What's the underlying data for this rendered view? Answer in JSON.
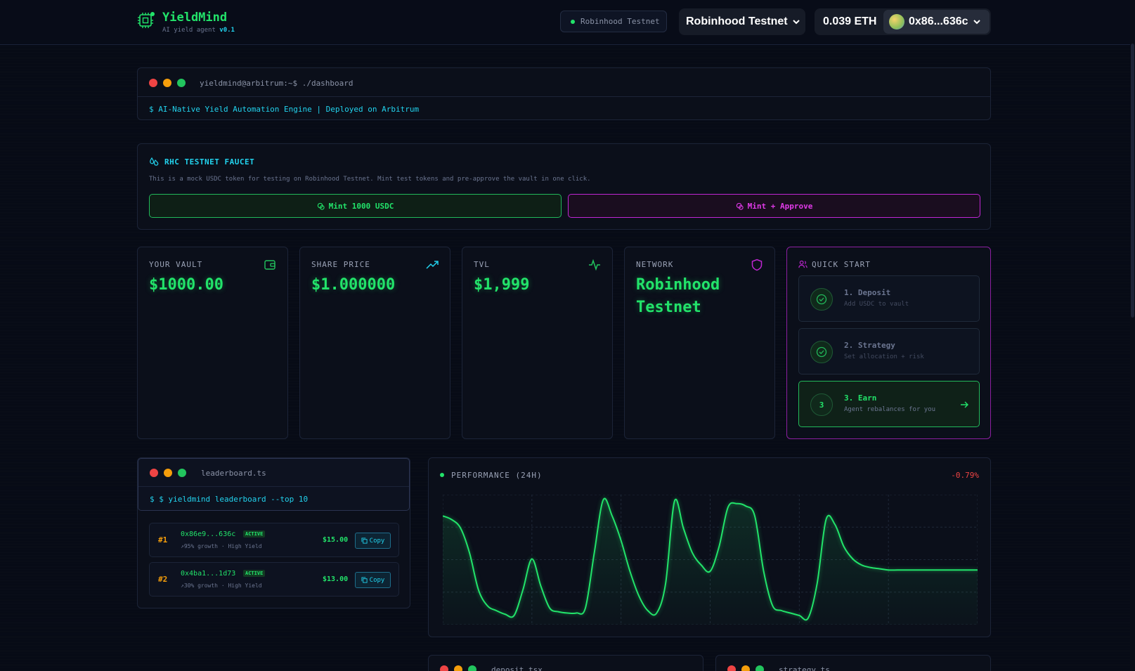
{
  "header": {
    "brand": "YieldMind",
    "tagline": "AI yield agent",
    "version": "v0.1",
    "network_pill": "Robinhood Testnet",
    "network_select": "Robinhood Testnet",
    "balance": "0.039 ETH",
    "account": "0x86...636c"
  },
  "terminal": {
    "title": "yieldmind@arbitrum:~$ ./dashboard",
    "command": "$ AI-Native Yield Automation Engine | Deployed on Arbitrum"
  },
  "faucet": {
    "title": "RHC TESTNET FAUCET",
    "description": "This is a mock USDC token for testing on Robinhood Testnet. Mint test tokens and pre-approve the vault in one click.",
    "mint_label": "Mint 1000 USDC",
    "approve_label": "Mint + Approve"
  },
  "stats": [
    {
      "label": "YOUR VAULT",
      "value": "$1000.00",
      "icon": "wallet-icon"
    },
    {
      "label": "SHARE PRICE",
      "value": "$1.000000",
      "icon": "trending-up-icon"
    },
    {
      "label": "TVL",
      "value": "$1,999",
      "icon": "activity-icon"
    },
    {
      "label": "NETWORK",
      "value": "Robinhood Testnet",
      "icon": "shield-icon"
    }
  ],
  "quickstart": {
    "title": "QUICK START",
    "steps": [
      {
        "title": "1. Deposit",
        "sub": "Add USDC to vault"
      },
      {
        "title": "2. Strategy",
        "sub": "Set allocation + risk"
      },
      {
        "title": "3. Earn",
        "sub": "Agent rebalances for you",
        "num": "3"
      }
    ]
  },
  "leaderboard": {
    "title": "leaderboard.ts",
    "command": "$ $ yieldmind leaderboard --top 10",
    "rows": [
      {
        "rank": "#1",
        "address": "0x86e9...636c",
        "badge": "ACTIVE",
        "growth": "95% growth",
        "tier": "· High Yield",
        "amount": "$15.00",
        "copy": "Copy"
      },
      {
        "rank": "#2",
        "address": "0x4ba1...1d73",
        "badge": "ACTIVE",
        "growth": "30% growth",
        "tier": "· High Yield",
        "amount": "$13.00",
        "copy": "Copy"
      }
    ]
  },
  "performance": {
    "title": "PERFORMANCE (24H)",
    "change": "-0.79%"
  },
  "bottom": {
    "left_title": "deposit.tsx",
    "right_title": "strategy.ts"
  },
  "colors": {
    "accent_green": "#22e36a",
    "accent_cyan": "#22d3ee",
    "accent_magenta": "#e03ae8",
    "negative": "#ef4444"
  },
  "chart_data": {
    "type": "line",
    "title": "PERFORMANCE (24H)",
    "x": [
      0,
      1,
      2,
      3,
      4,
      5,
      6,
      7,
      8,
      9,
      10,
      11,
      12,
      13,
      14,
      15,
      16,
      17,
      18,
      19,
      20,
      21,
      22,
      23,
      24,
      25,
      26,
      27,
      28,
      29,
      30,
      31,
      32,
      33,
      34,
      35,
      36,
      37,
      38,
      39,
      40,
      41,
      42,
      43,
      44,
      45,
      46,
      47,
      48,
      49,
      50,
      51,
      52,
      53,
      54,
      55,
      56,
      57,
      58,
      59,
      60
    ],
    "series": [
      {
        "values": [
          0.85,
          0.82,
          0.75,
          0.55,
          0.25,
          0.12,
          0.08,
          0.05,
          0.04,
          0.25,
          0.5,
          0.28,
          0.1,
          0.07,
          0.06,
          0.06,
          0.1,
          0.55,
          0.98,
          0.85,
          0.65,
          0.4,
          0.2,
          0.08,
          0.06,
          0.3,
          0.97,
          0.75,
          0.55,
          0.45,
          0.4,
          0.6,
          0.92,
          0.95,
          0.93,
          0.85,
          0.4,
          0.12,
          0.08,
          0.06,
          0.04,
          0.02,
          0.3,
          0.82,
          0.78,
          0.6,
          0.5,
          0.45,
          0.43,
          0.42,
          0.41,
          0.41,
          0.41,
          0.41,
          0.41,
          0.41,
          0.41,
          0.41,
          0.41,
          0.41,
          0.41
        ]
      }
    ],
    "xlabel": "",
    "ylabel": "",
    "ylim": [
      0,
      1
    ],
    "grid": true
  }
}
